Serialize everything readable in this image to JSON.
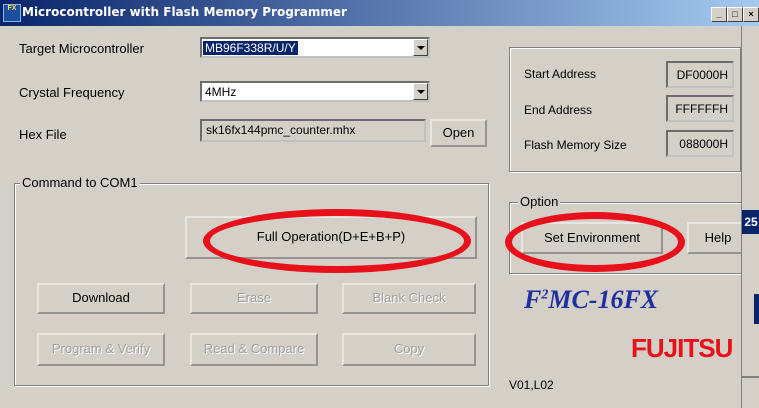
{
  "window": {
    "title": "Microcontroller with Flash Memory Programmer",
    "icon_text": "Flash FX",
    "controls": [
      "_",
      "□",
      "×"
    ]
  },
  "form": {
    "target_label": "Target Microcontroller",
    "target_value": "MB96F338R/U/Y",
    "crystal_label": "Crystal Frequency",
    "crystal_value": "4MHz",
    "hex_label": "Hex File",
    "hex_value": "sk16fx144pmc_counter.mhx",
    "open_label": "Open"
  },
  "address": {
    "start_label": "Start Address",
    "start_value": "DF0000H",
    "end_label": "End Address",
    "end_value": "FFFFFFH",
    "size_label": "Flash Memory Size",
    "size_value": "088000H"
  },
  "command": {
    "group_title": "Command to COM1",
    "full_operation": "Full Operation(D+E+B+P)",
    "download": "Download",
    "erase": "Erase",
    "blank_check": "Blank Check",
    "program_verify": "Program & Verify",
    "read_compare": "Read & Compare",
    "copy": "Copy"
  },
  "option": {
    "group_title": "Option",
    "set_environment": "Set Environment",
    "help": "Help"
  },
  "branding": {
    "product_prefix": "F",
    "product_sup": "2",
    "product_suffix": "MC-16FX",
    "company": "FUJITSU",
    "version": "V01,L02",
    "side_text": "25"
  },
  "colors": {
    "annotation_ring": "#e8101a",
    "titlebar": "#0a246a",
    "brand_blue": "#2030a0"
  }
}
